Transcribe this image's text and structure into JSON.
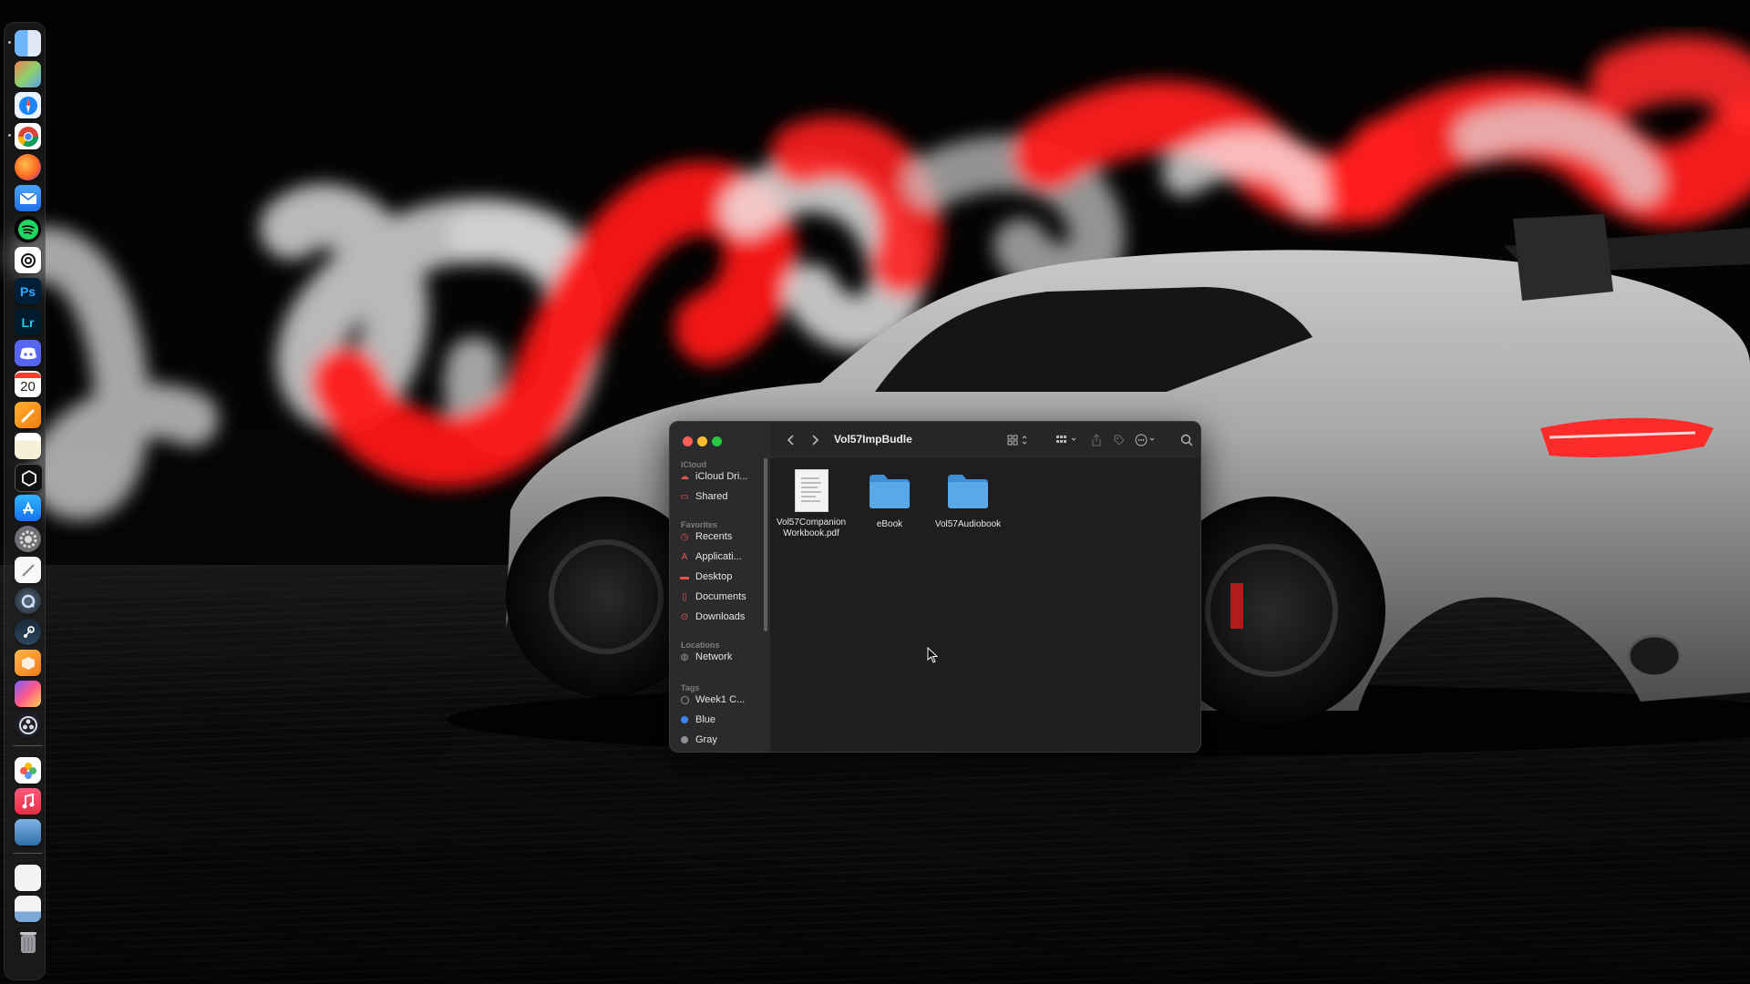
{
  "window": {
    "title": "Vol57ImpBudle"
  },
  "sidebar": {
    "sections": [
      {
        "label": "iCloud"
      },
      {
        "label": "Favorites"
      },
      {
        "label": "Locations"
      },
      {
        "label": "Tags"
      }
    ],
    "icloud": [
      {
        "label": "iCloud Dri...",
        "icon": "cloud-icon"
      },
      {
        "label": "Shared",
        "icon": "shared-folder-icon"
      }
    ],
    "favorites": [
      {
        "label": "Recents",
        "icon": "clock-icon"
      },
      {
        "label": "Applicati...",
        "icon": "applications-icon"
      },
      {
        "label": "Desktop",
        "icon": "desktop-icon"
      },
      {
        "label": "Documents",
        "icon": "document-icon"
      },
      {
        "label": "Downloads",
        "icon": "download-icon"
      }
    ],
    "locations": [
      {
        "label": "Network",
        "icon": "globe-icon"
      }
    ],
    "tags": [
      {
        "label": "Week1 C...",
        "color": "#8e8e93"
      },
      {
        "label": "Blue",
        "color": "#3b82f6"
      },
      {
        "label": "Gray",
        "color": "#8e8e93"
      }
    ]
  },
  "files": [
    {
      "label_line1": "Vol57Companion",
      "label_line2": "Workbook.pdf",
      "kind": "pdf"
    },
    {
      "label_line1": "eBook",
      "label_line2": "",
      "kind": "folder"
    },
    {
      "label_line1": "Vol57Audiobook",
      "label_line2": "",
      "kind": "folder"
    }
  ],
  "dock": {
    "calendar_day": "20",
    "photoshop_label": "Ps",
    "lightroom_label": "Lr"
  },
  "colors": {
    "close": "#ff5f57",
    "minimize": "#febc2e",
    "zoom": "#28c840",
    "folder": "#5aa8e8",
    "accent_red": "#e5534b"
  }
}
